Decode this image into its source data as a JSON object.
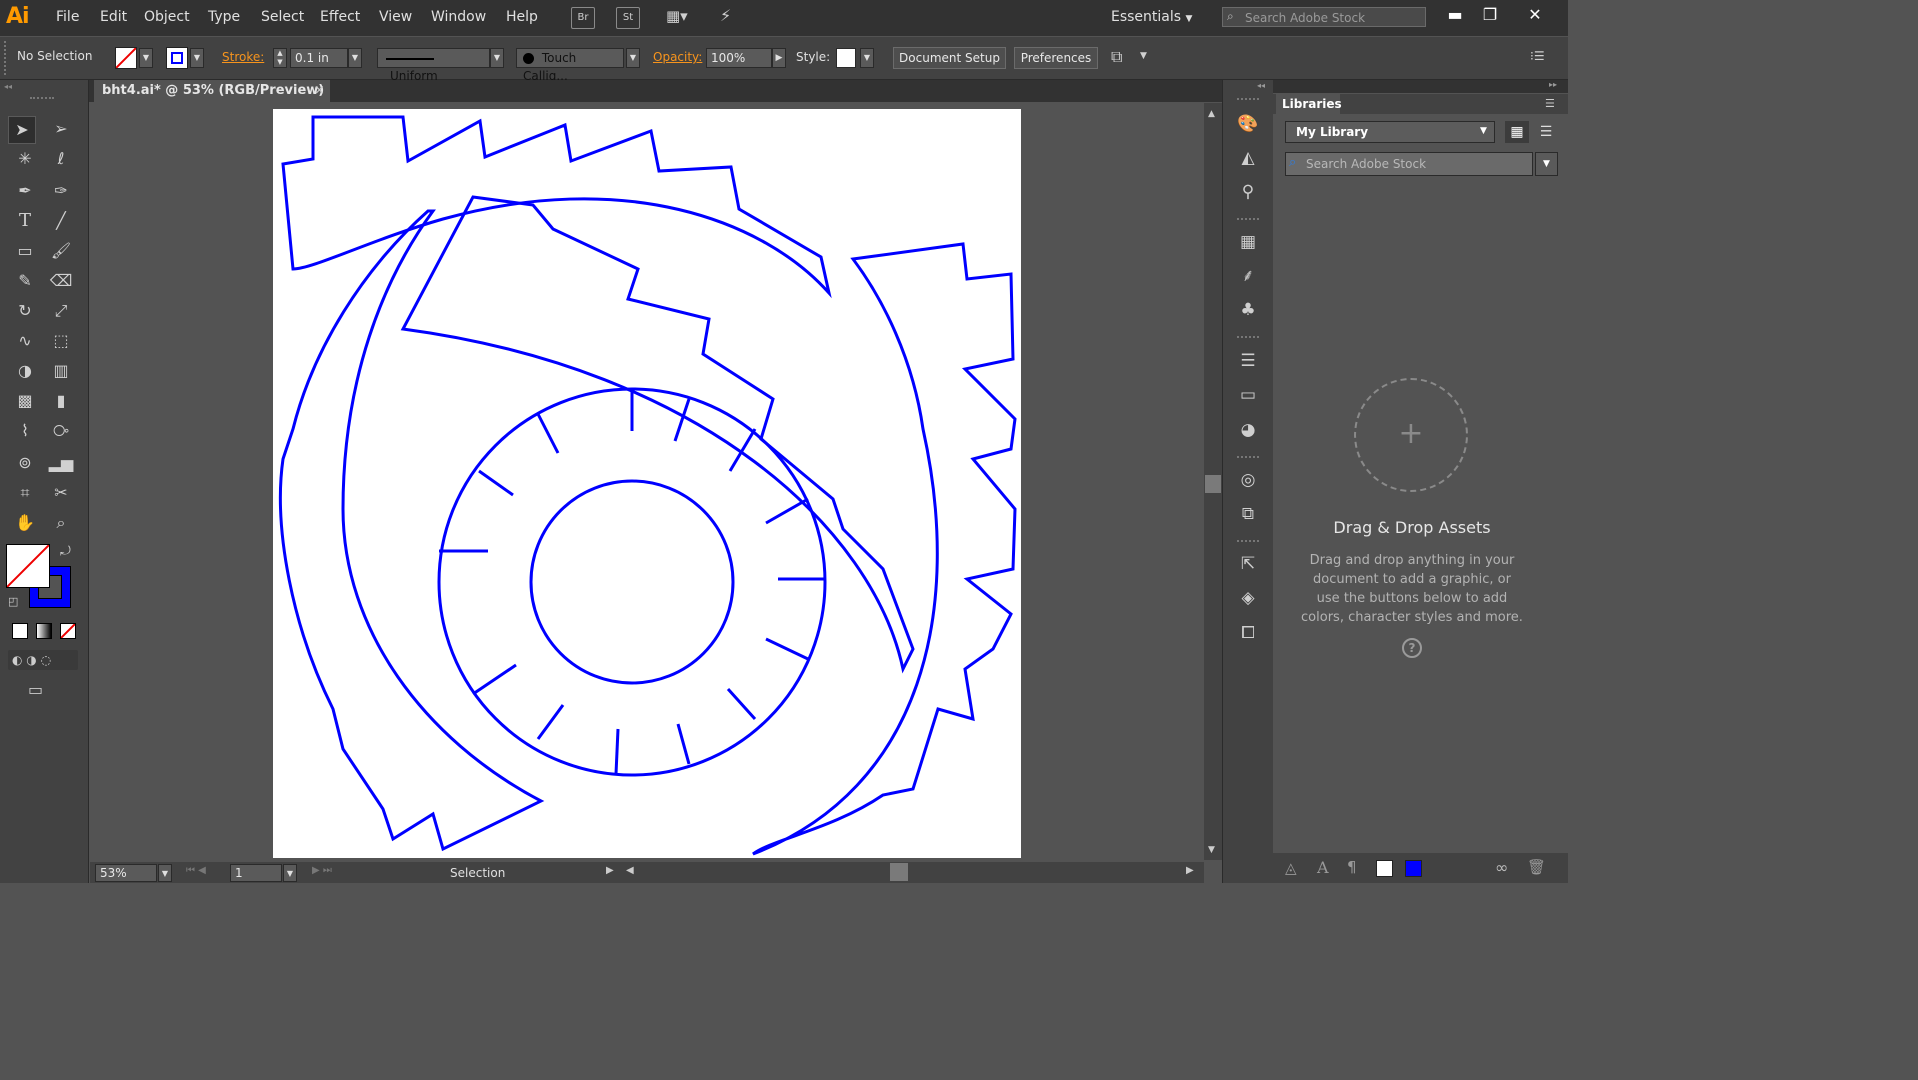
{
  "app": {
    "logo": "Ai",
    "doc_tab": "bht4.ai* @ 53% (RGB/Preview)",
    "tab_close": "×"
  },
  "menu": {
    "items": [
      "File",
      "Edit",
      "Object",
      "Type",
      "Select",
      "Effect",
      "View",
      "Window",
      "Help"
    ],
    "bridge": "Br",
    "stock": "St",
    "workspace": "Essentials",
    "search_placeholder": "Search Adobe Stock"
  },
  "window": {
    "minimize": "▬",
    "restore": "❐",
    "close": "✕"
  },
  "control": {
    "selection": "No Selection",
    "stroke_label": "Stroke:",
    "stroke_weight": "0.1 in",
    "profile": "Uniform",
    "brush": "Touch Callig...",
    "opacity_label": "Opacity:",
    "opacity_value": "100%",
    "style_label": "Style:",
    "document_setup": "Document Setup",
    "preferences": "Preferences"
  },
  "status": {
    "zoom": "53%",
    "artboard_index": "1",
    "tool_name": "Selection"
  },
  "libraries": {
    "tab": "Libraries",
    "library_name": "My Library",
    "search_placeholder": "Search Adobe Stock",
    "drop_title": "Drag & Drop Assets",
    "drop_desc": "Drag and drop anything in your document to add a graphic, or use the buttons below to add colors, character styles and more.",
    "help": "?"
  },
  "colors": {
    "stroke": "#0000ff",
    "accent": "#f7941d",
    "artboard": "#ffffff"
  }
}
